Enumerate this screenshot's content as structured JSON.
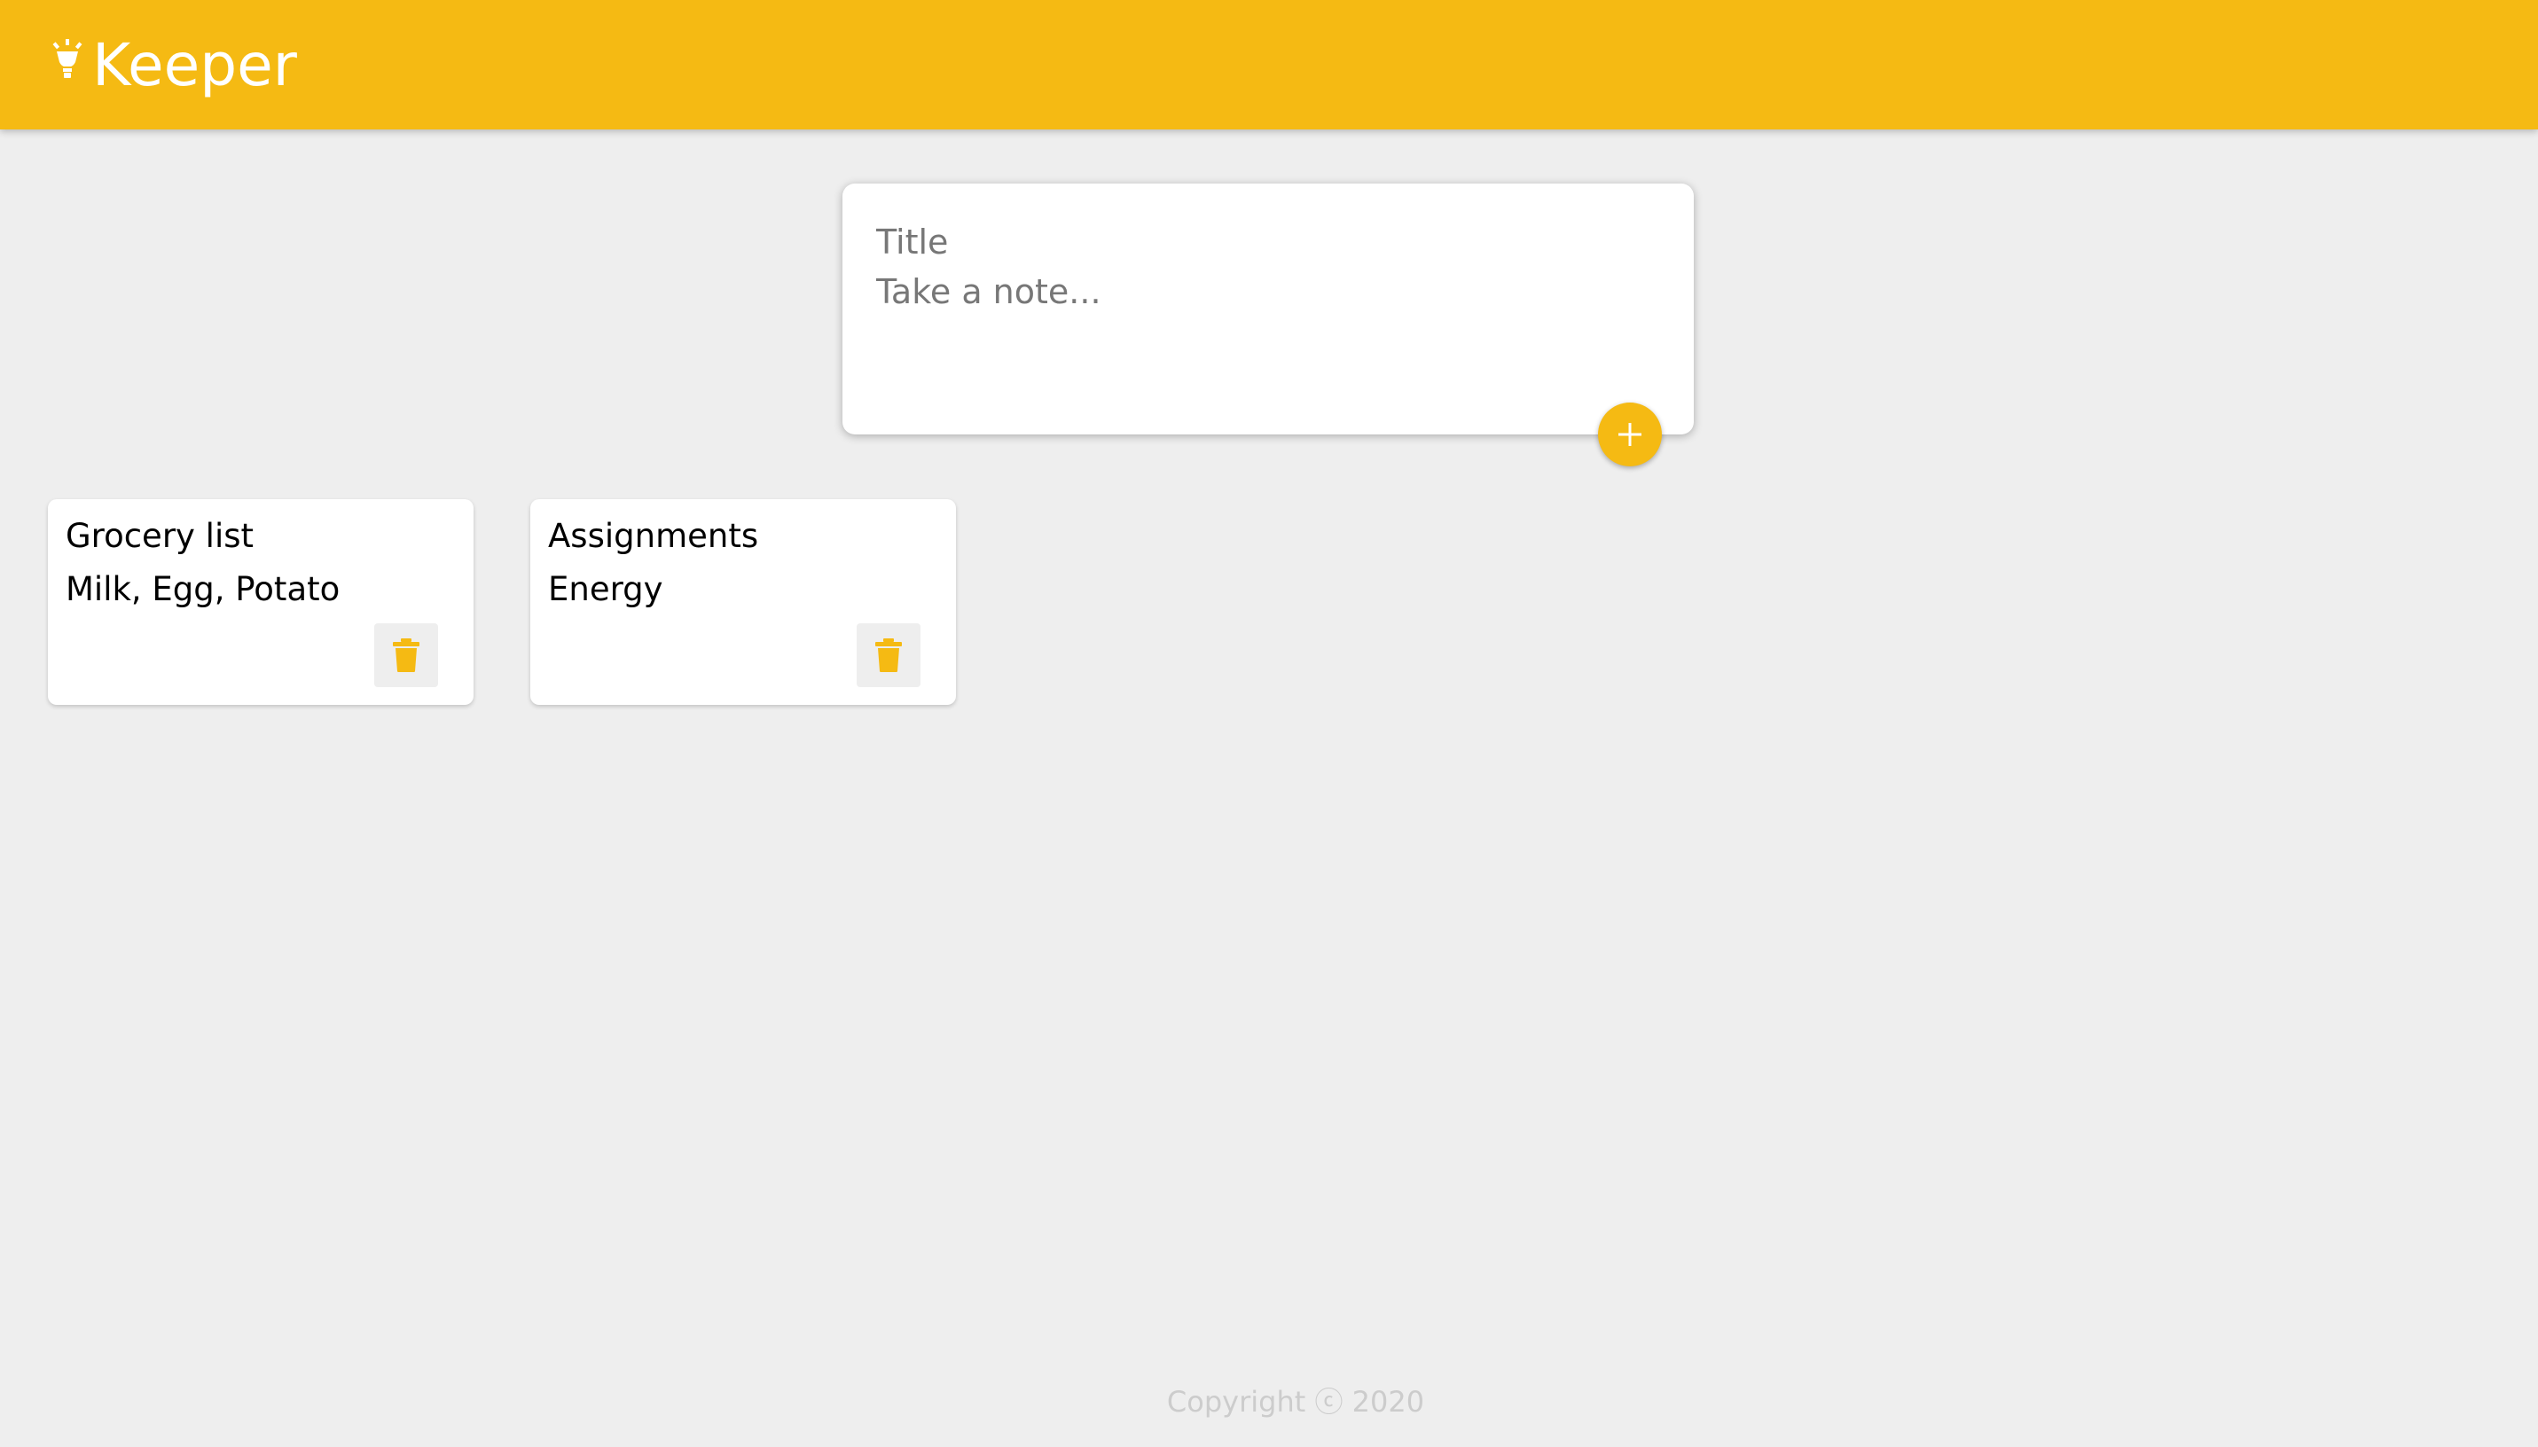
{
  "header": {
    "app_name": "Keeper",
    "logo_icon": "lightbulb-icon"
  },
  "create_note": {
    "title_placeholder": "Title",
    "content_placeholder": "Take a note...",
    "add_icon": "plus-icon"
  },
  "notes": [
    {
      "title": "Grocery list",
      "content": "Milk, Egg, Potato",
      "delete_icon": "trash-icon"
    },
    {
      "title": "Assignments",
      "content": "Energy",
      "delete_icon": "trash-icon"
    }
  ],
  "footer": {
    "copyright": "Copyright ⓒ 2020"
  },
  "colors": {
    "brand": "#f5ba13",
    "background": "#eeeeee",
    "footer_text": "#cccccc"
  }
}
